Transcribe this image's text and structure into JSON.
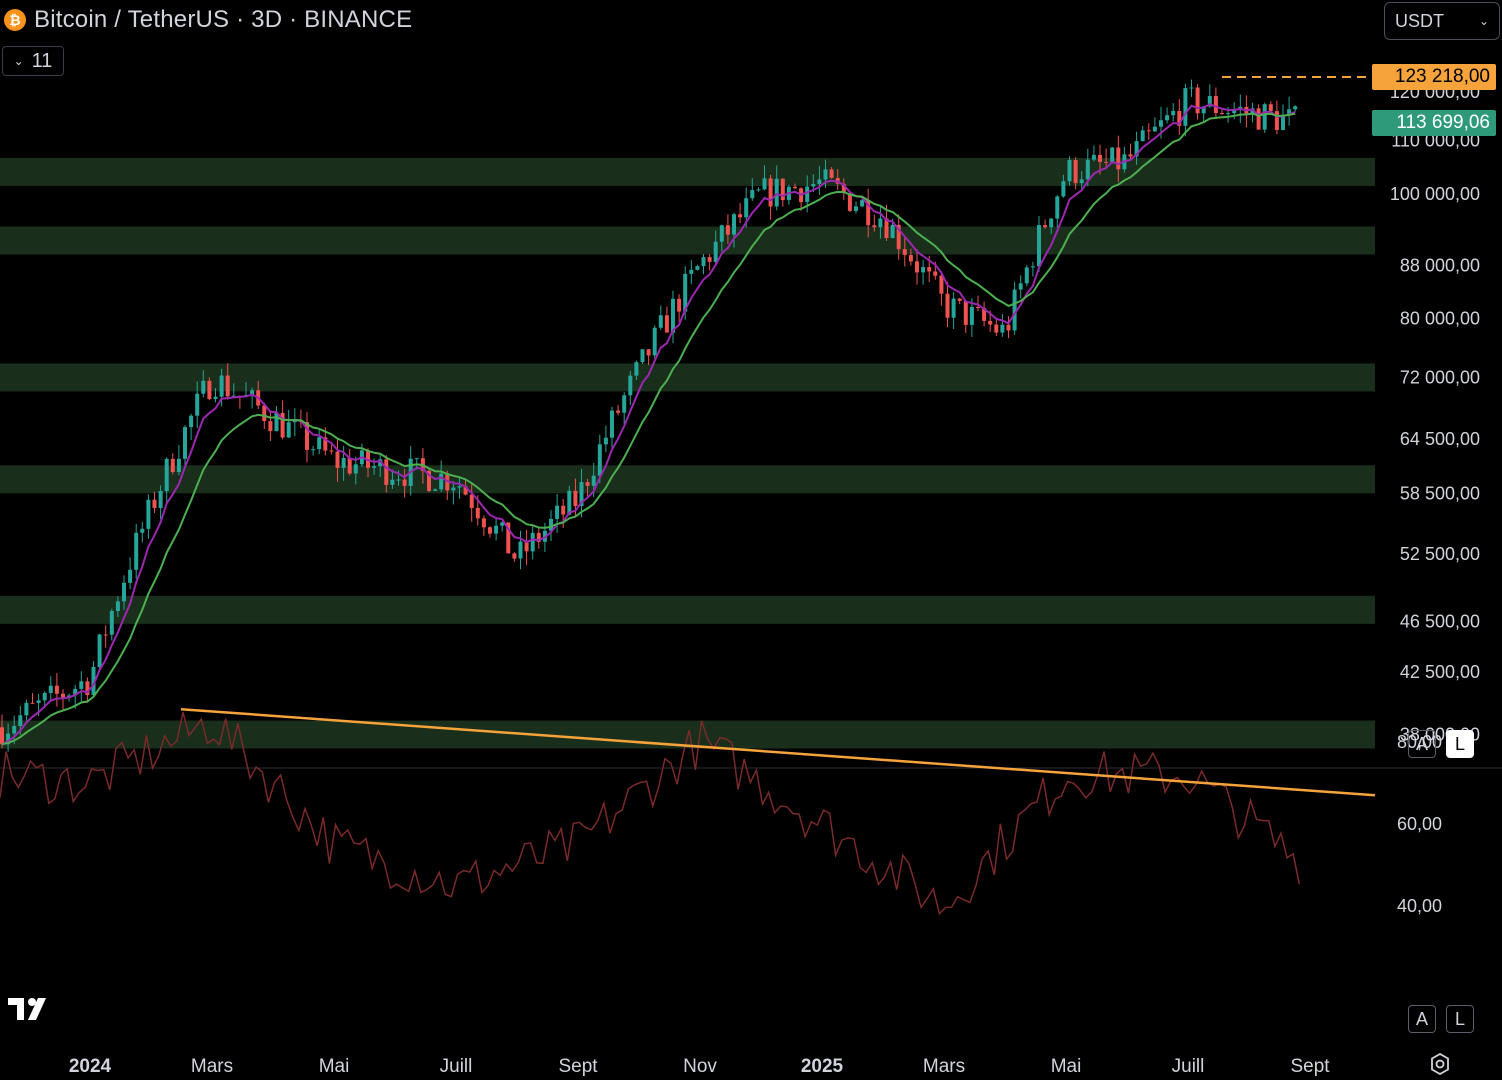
{
  "header": {
    "symbol_title": "Bitcoin / TetherUS · 3D · BINANCE",
    "indicator_toggle_count": "11",
    "currency": "USDT",
    "coin_icon": "bitcoin-icon"
  },
  "price_scale": {
    "ticks": [
      "120 000,00",
      "110 000,00",
      "100 000,00",
      "88 000,00",
      "80 000,00",
      "72 000,00",
      "64 500,00",
      "58 500,00",
      "52 500,00",
      "46 500,00",
      "42 500,00",
      "38 000,00"
    ],
    "high_label": "123 218,00",
    "last_label": "113 699,06",
    "auto_button": "A",
    "log_button": "L"
  },
  "indicator_scale": {
    "ticks": [
      "80,00",
      "60,00",
      "40,00"
    ],
    "auto_button": "A",
    "log_button": "L"
  },
  "time_axis": {
    "labels": [
      {
        "text": "2024",
        "bold": true
      },
      {
        "text": "Mars",
        "bold": false
      },
      {
        "text": "Mai",
        "bold": false
      },
      {
        "text": "Juill",
        "bold": false
      },
      {
        "text": "Sept",
        "bold": false
      },
      {
        "text": "Nov",
        "bold": false
      },
      {
        "text": "2025",
        "bold": true
      },
      {
        "text": "Mars",
        "bold": false
      },
      {
        "text": "Mai",
        "bold": false
      },
      {
        "text": "Juill",
        "bold": false
      },
      {
        "text": "Sept",
        "bold": false
      }
    ]
  },
  "colors": {
    "background": "#000000",
    "candle_up": "#26a69a",
    "candle_down": "#ef5350",
    "ma_fast": "#9c27b0",
    "ma_slow": "#4caf50",
    "zone": "#1a2e1c",
    "indicator_line": "#7a2a2a",
    "trendline": "#f5a33a"
  },
  "chart_data": [
    {
      "type": "candlestick",
      "series": [
        {
          "name": "BTCUSDT 3D candles"
        },
        {
          "name": "fast moving average"
        },
        {
          "name": "slow moving average"
        }
      ],
      "key_points": [
        {
          "x": "2024-01",
          "y": 42000
        },
        {
          "x": "2024-03",
          "y": 72000
        },
        {
          "x": "2024-05",
          "y": 62000
        },
        {
          "x": "2024-07",
          "y": 60000
        },
        {
          "x": "2024-08",
          "y": 52000
        },
        {
          "x": "2024-09",
          "y": 58000
        },
        {
          "x": "2024-11",
          "y": 88000
        },
        {
          "x": "2024-12",
          "y": 100000
        },
        {
          "x": "2025-01",
          "y": 102000
        },
        {
          "x": "2025-02",
          "y": 96000
        },
        {
          "x": "2025-03",
          "y": 82000
        },
        {
          "x": "2025-04",
          "y": 78000
        },
        {
          "x": "2025-05",
          "y": 104000
        },
        {
          "x": "2025-06",
          "y": 106000
        },
        {
          "x": "2025-07",
          "y": 118000
        },
        {
          "x": "2025-08",
          "y": 113699.06
        }
      ],
      "support_zones": [
        104000,
        92000,
        72000,
        60000,
        47500,
        38000
      ],
      "ylim": [
        35000,
        126000
      ],
      "log_scale": true
    },
    {
      "type": "line",
      "series": [
        {
          "name": "oscillator"
        }
      ],
      "key_points": [
        {
          "x": "2024-01",
          "y": 70
        },
        {
          "x": "2024-03",
          "y": 85
        },
        {
          "x": "2024-05",
          "y": 55
        },
        {
          "x": "2024-07",
          "y": 45
        },
        {
          "x": "2024-09",
          "y": 55
        },
        {
          "x": "2024-11",
          "y": 80
        },
        {
          "x": "2025-01",
          "y": 60
        },
        {
          "x": "2025-03",
          "y": 40
        },
        {
          "x": "2025-05",
          "y": 72
        },
        {
          "x": "2025-07",
          "y": 72
        },
        {
          "x": "2025-08",
          "y": 51
        }
      ],
      "trendline": [
        {
          "x": "2024-02",
          "y": 88
        },
        {
          "x": "2025-08",
          "y": 67
        }
      ],
      "ylim": [
        35,
        95
      ]
    }
  ]
}
